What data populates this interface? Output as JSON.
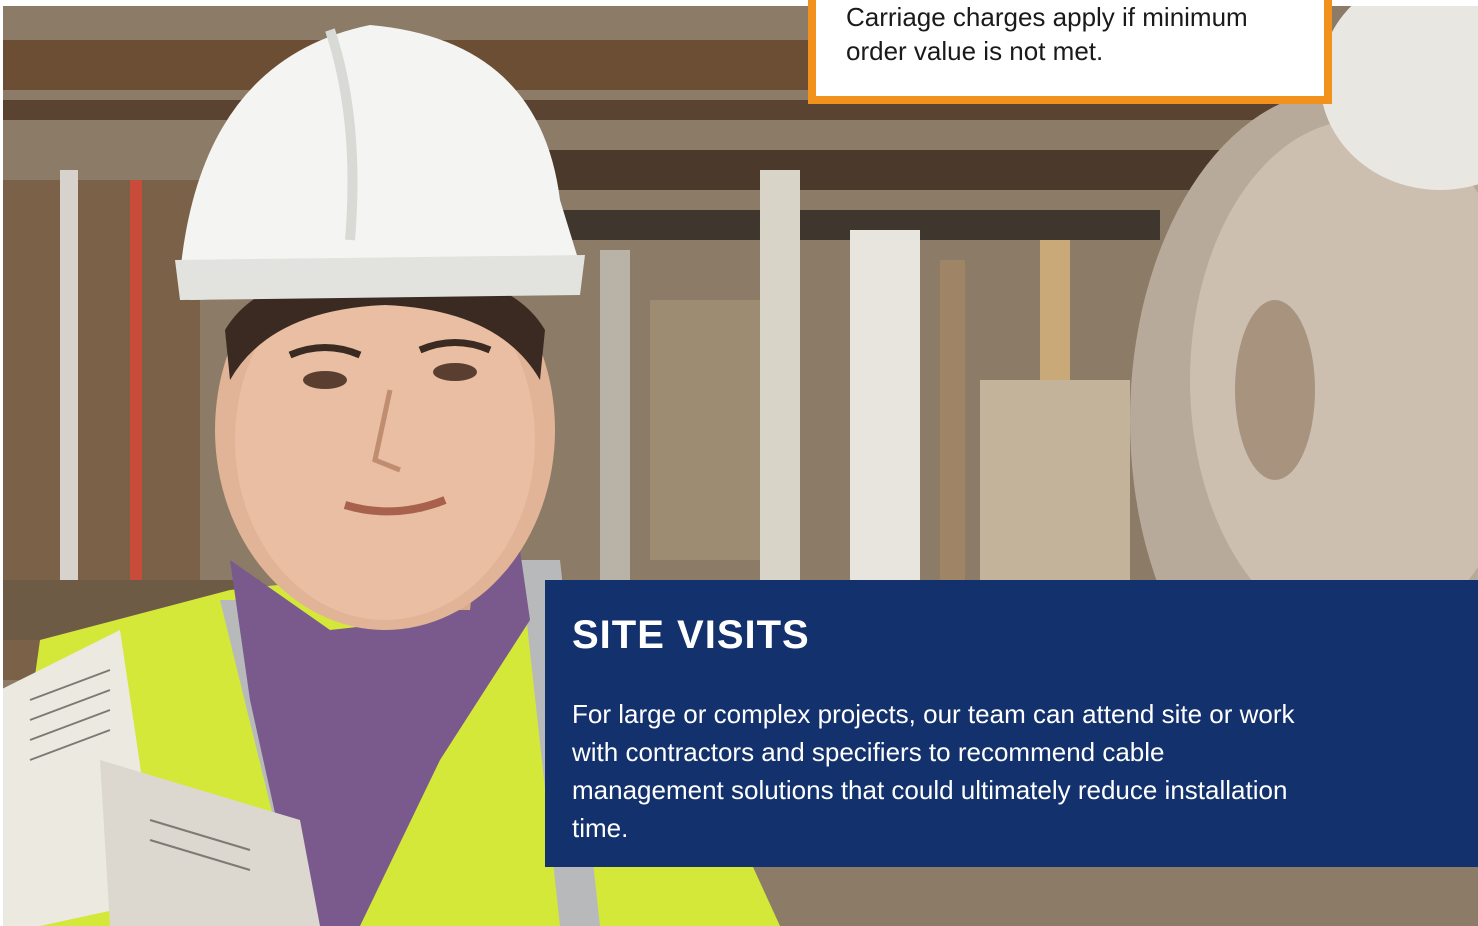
{
  "notice": {
    "text": "Carriage charges apply if minimum order value is not met."
  },
  "site_visits": {
    "title": "SITE VISITS",
    "body": "For large or complex projects, our team can attend site or work with contractors and specifiers to recommend cable management solutions that could ultimately reduce installation time."
  },
  "colors": {
    "panel_blue": "#13326d",
    "notice_border_orange": "#f2911b",
    "hi_vis_yellow": "#d4e83a",
    "hard_hat_white": "#f4f4f2"
  }
}
